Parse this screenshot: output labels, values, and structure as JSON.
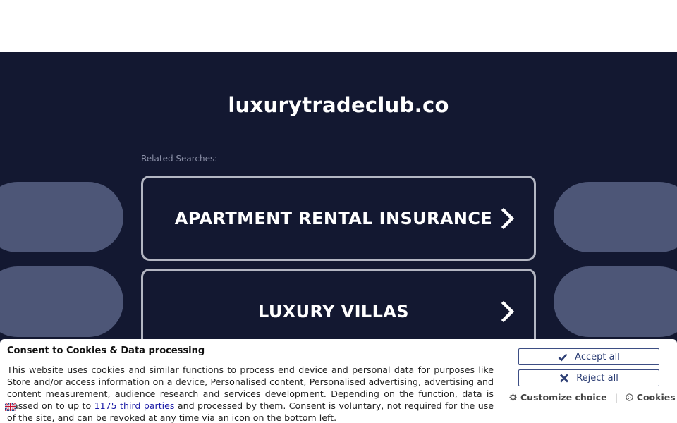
{
  "page": {
    "domain": "luxurytradeclub.co",
    "related_label": "Related Searches:",
    "links": [
      {
        "label": "APARTMENT RENTAL INSURANCE"
      },
      {
        "label": "LUXURY VILLAS"
      }
    ]
  },
  "consent": {
    "title": "Consent to Cookies & Data processing",
    "text_before": "This website uses cookies and similar functions to process end device and personal data for purposes like Store and/or access information on a device, Personalised content, Personalised advertising, advertising and content measurement, audience research and services development. Depending on the function, data is passed on to up to ",
    "third_parties_link": "1175 third parties",
    "text_after": " and processed by them. Consent is voluntary, not required for the use of the site, and can be revoked at any time via an icon on the bottom left.",
    "accept_label": "Accept all",
    "reject_label": "Reject all",
    "customize_label": "Customize choice",
    "separator": "|",
    "cookies_label": "Cookies"
  },
  "colors": {
    "background_dark": "#131831",
    "pill": "#4d5677",
    "button_border": "#3d4e84",
    "link_blue": "#1a1aa6"
  },
  "icons": [
    "chevron-right-icon",
    "check-icon",
    "x-icon",
    "gear-icon",
    "cookie-icon",
    "uk-flag-icon"
  ]
}
